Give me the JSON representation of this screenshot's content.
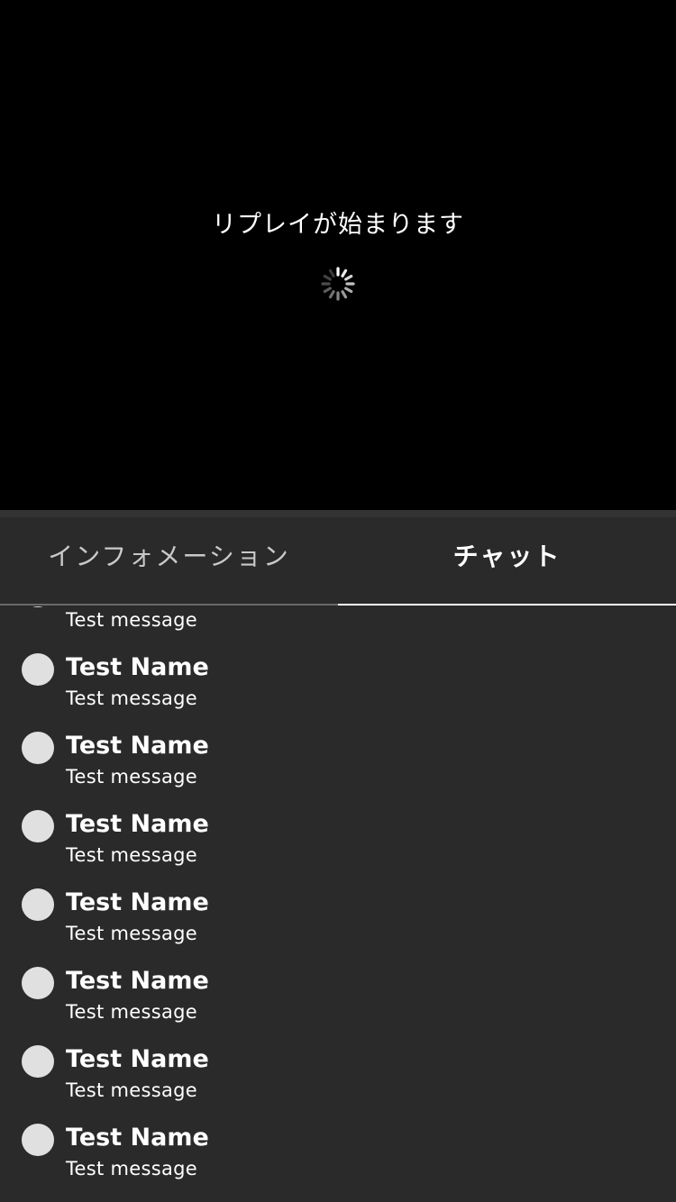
{
  "player": {
    "status_text": "リプレイが始まります",
    "spinner_icon": "loading-spinner-icon"
  },
  "tabs": [
    {
      "label": "インフォメーション",
      "active": false
    },
    {
      "label": "チャット",
      "active": true
    }
  ],
  "chat": {
    "partial_top_message": "Test message",
    "items": [
      {
        "name": "Test Name",
        "message": "Test message"
      },
      {
        "name": "Test Name",
        "message": "Test message"
      },
      {
        "name": "Test Name",
        "message": "Test message"
      },
      {
        "name": "Test Name",
        "message": "Test message"
      },
      {
        "name": "Test Name",
        "message": "Test message"
      },
      {
        "name": "Test Name",
        "message": "Test message"
      },
      {
        "name": "Test Name",
        "message": "Test message"
      }
    ]
  },
  "colors": {
    "player_background": "#000000",
    "panel_background": "#2a2a2a",
    "avatar": "#e0e0e0",
    "active_tab_indicator": "#ffffff"
  }
}
